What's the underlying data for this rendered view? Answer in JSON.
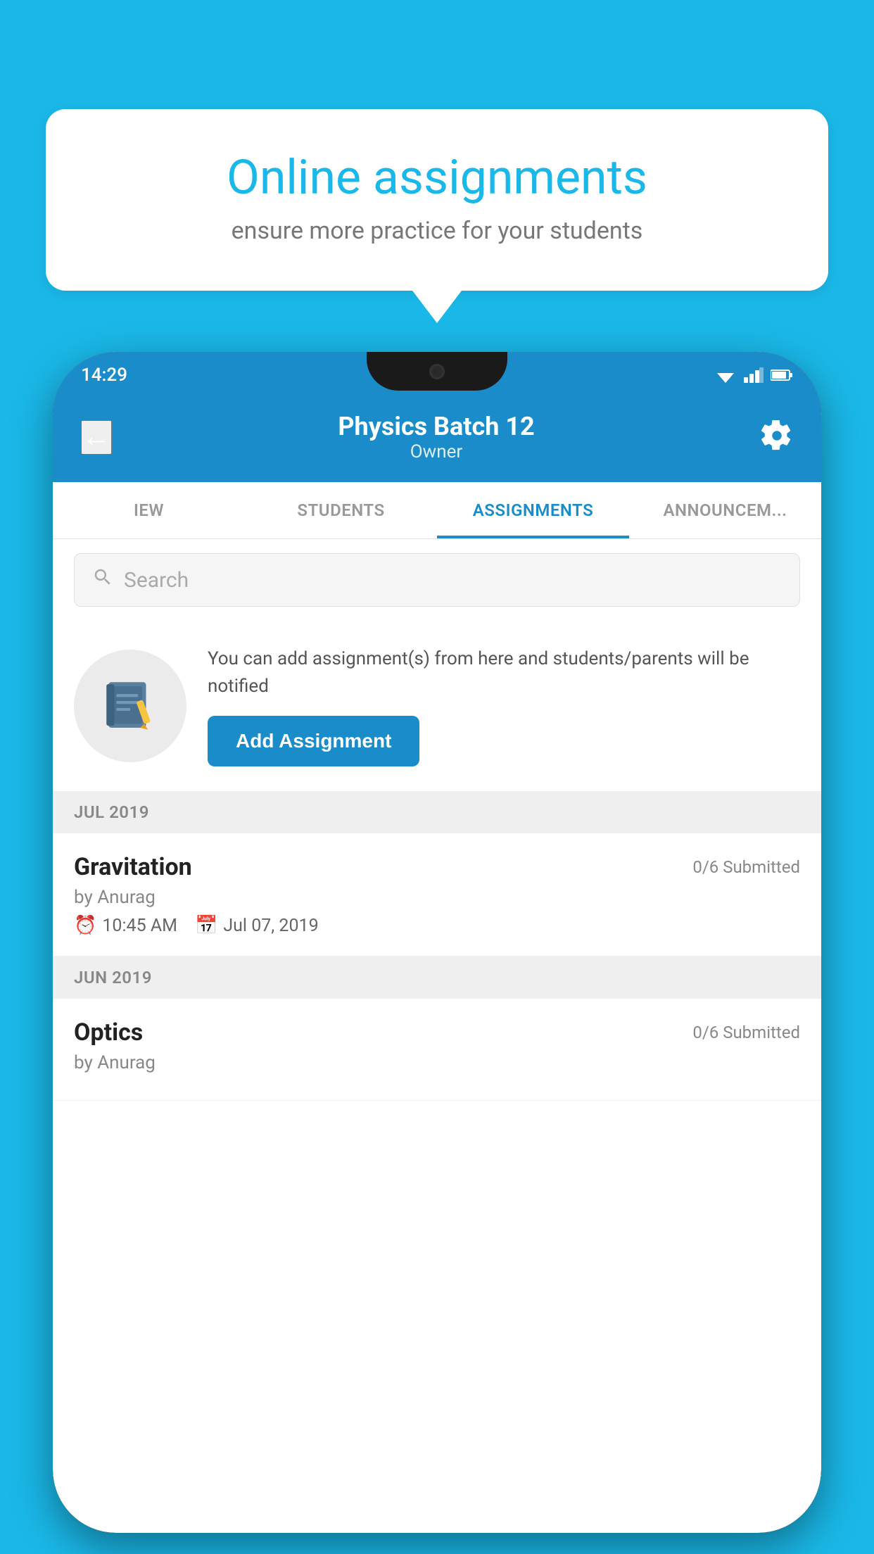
{
  "background_color": "#1ab8e8",
  "speech_bubble": {
    "title": "Online assignments",
    "subtitle": "ensure more practice for your students"
  },
  "status_bar": {
    "time": "14:29"
  },
  "header": {
    "title": "Physics Batch 12",
    "subtitle": "Owner",
    "back_label": "←"
  },
  "tabs": [
    {
      "label": "IEW",
      "active": false
    },
    {
      "label": "STUDENTS",
      "active": false
    },
    {
      "label": "ASSIGNMENTS",
      "active": true
    },
    {
      "label": "ANNOUNCEM...",
      "active": false
    }
  ],
  "search": {
    "placeholder": "Search"
  },
  "promo": {
    "text": "You can add assignment(s) from here and students/parents will be notified",
    "button_label": "Add Assignment"
  },
  "sections": [
    {
      "label": "JUL 2019",
      "assignments": [
        {
          "name": "Gravitation",
          "submitted": "0/6 Submitted",
          "by": "by Anurag",
          "time": "10:45 AM",
          "date": "Jul 07, 2019"
        }
      ]
    },
    {
      "label": "JUN 2019",
      "assignments": [
        {
          "name": "Optics",
          "submitted": "0/6 Submitted",
          "by": "by Anurag",
          "time": "",
          "date": ""
        }
      ]
    }
  ]
}
